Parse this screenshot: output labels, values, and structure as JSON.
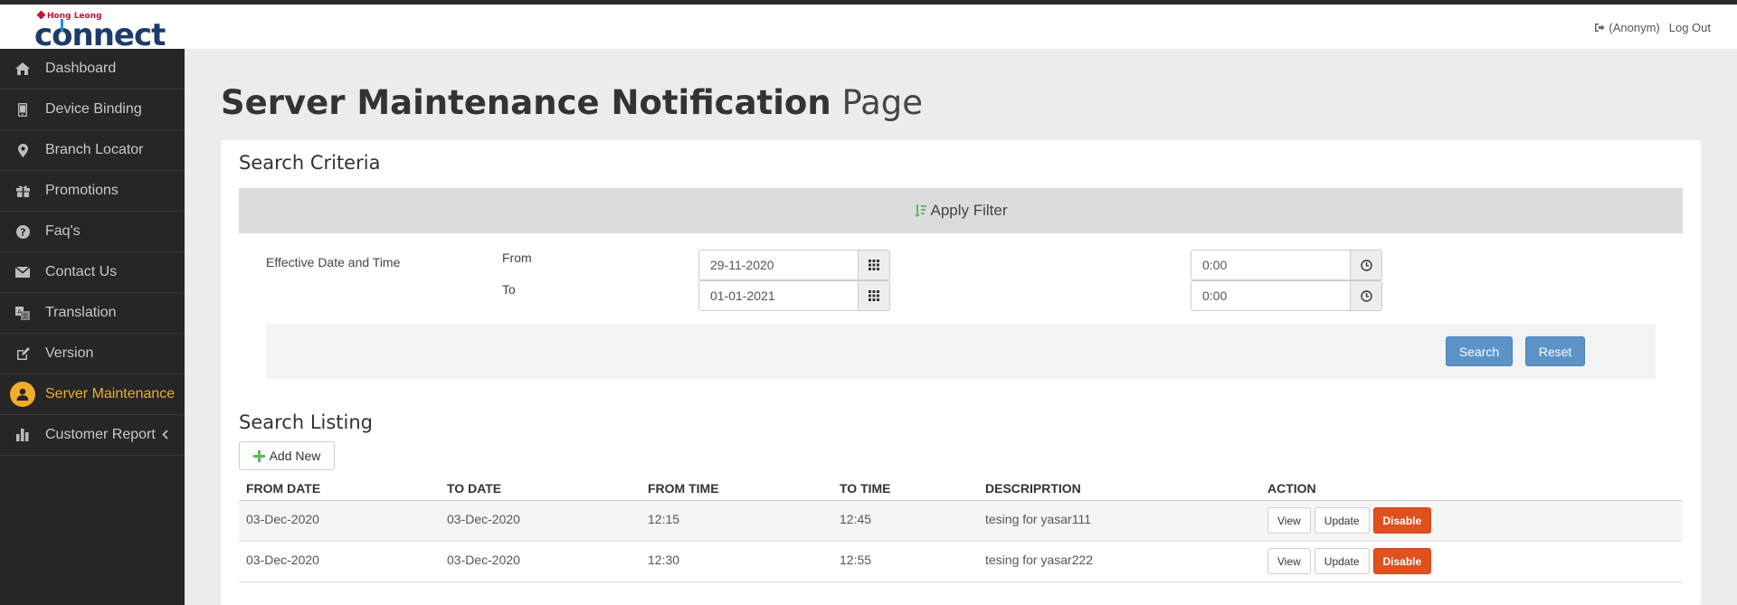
{
  "brand": {
    "small": "Hong Leong",
    "main_pre": "c",
    "main_o": "o",
    "main_post": "nnect"
  },
  "header": {
    "user": "(Anonym)",
    "logout": "Log Out"
  },
  "sidebar": {
    "items": [
      {
        "label": "Dashboard",
        "icon": "home-icon"
      },
      {
        "label": "Device Binding",
        "icon": "mobile-icon"
      },
      {
        "label": "Branch Locator",
        "icon": "map-marker-icon"
      },
      {
        "label": "Promotions",
        "icon": "gift-icon"
      },
      {
        "label": "Faq's",
        "icon": "question-circle-icon"
      },
      {
        "label": "Contact Us",
        "icon": "envelope-icon"
      },
      {
        "label": "Translation",
        "icon": "translate-icon"
      },
      {
        "label": "Version",
        "icon": "edit-icon"
      },
      {
        "label": "Server Maintenance",
        "icon": "user-icon",
        "active": true
      },
      {
        "label": "Customer Report",
        "icon": "bar-chart-icon"
      }
    ],
    "accent": "#f0ad2b"
  },
  "page": {
    "title_bold": "Server Maintenance Notification",
    "title_light": "Page"
  },
  "search": {
    "title": "Search Criteria",
    "filter_label": "Apply Filter",
    "field_label": "Effective Date and Time",
    "from_label": "From",
    "to_label": "To",
    "from_date": "29-11-2020",
    "to_date": "01-01-2021",
    "from_time": "0:00",
    "to_time": "0:00",
    "search_btn": "Search",
    "reset_btn": "Reset"
  },
  "listing": {
    "title": "Search Listing",
    "add_btn": "Add New",
    "columns": [
      "FROM DATE",
      "TO DATE",
      "FROM TIME",
      "TO TIME",
      "DESCRIPRTION",
      "ACTION"
    ],
    "rows": [
      {
        "from_date": "03-Dec-2020",
        "to_date": "03-Dec-2020",
        "from_time": "12:15",
        "to_time": "12:45",
        "description": "tesing for yasar111"
      },
      {
        "from_date": "03-Dec-2020",
        "to_date": "03-Dec-2020",
        "from_time": "12:30",
        "to_time": "12:55",
        "description": "tesing for yasar222"
      }
    ],
    "actions": {
      "view": "View",
      "update": "Update",
      "disable": "Disable"
    }
  }
}
